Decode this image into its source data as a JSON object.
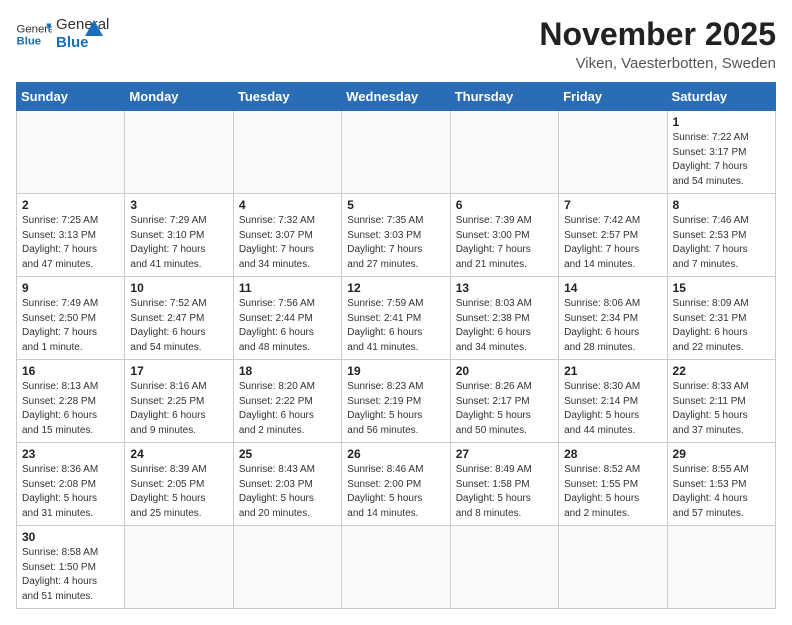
{
  "header": {
    "logo_general": "General",
    "logo_blue": "Blue",
    "title": "November 2025",
    "subtitle": "Viken, Vaesterbotten, Sweden"
  },
  "weekdays": [
    "Sunday",
    "Monday",
    "Tuesday",
    "Wednesday",
    "Thursday",
    "Friday",
    "Saturday"
  ],
  "weeks": [
    [
      {
        "day": "",
        "info": ""
      },
      {
        "day": "",
        "info": ""
      },
      {
        "day": "",
        "info": ""
      },
      {
        "day": "",
        "info": ""
      },
      {
        "day": "",
        "info": ""
      },
      {
        "day": "",
        "info": ""
      },
      {
        "day": "1",
        "info": "Sunrise: 7:22 AM\nSunset: 3:17 PM\nDaylight: 7 hours\nand 54 minutes."
      }
    ],
    [
      {
        "day": "2",
        "info": "Sunrise: 7:25 AM\nSunset: 3:13 PM\nDaylight: 7 hours\nand 47 minutes."
      },
      {
        "day": "3",
        "info": "Sunrise: 7:29 AM\nSunset: 3:10 PM\nDaylight: 7 hours\nand 41 minutes."
      },
      {
        "day": "4",
        "info": "Sunrise: 7:32 AM\nSunset: 3:07 PM\nDaylight: 7 hours\nand 34 minutes."
      },
      {
        "day": "5",
        "info": "Sunrise: 7:35 AM\nSunset: 3:03 PM\nDaylight: 7 hours\nand 27 minutes."
      },
      {
        "day": "6",
        "info": "Sunrise: 7:39 AM\nSunset: 3:00 PM\nDaylight: 7 hours\nand 21 minutes."
      },
      {
        "day": "7",
        "info": "Sunrise: 7:42 AM\nSunset: 2:57 PM\nDaylight: 7 hours\nand 14 minutes."
      },
      {
        "day": "8",
        "info": "Sunrise: 7:46 AM\nSunset: 2:53 PM\nDaylight: 7 hours\nand 7 minutes."
      }
    ],
    [
      {
        "day": "9",
        "info": "Sunrise: 7:49 AM\nSunset: 2:50 PM\nDaylight: 7 hours\nand 1 minute."
      },
      {
        "day": "10",
        "info": "Sunrise: 7:52 AM\nSunset: 2:47 PM\nDaylight: 6 hours\nand 54 minutes."
      },
      {
        "day": "11",
        "info": "Sunrise: 7:56 AM\nSunset: 2:44 PM\nDaylight: 6 hours\nand 48 minutes."
      },
      {
        "day": "12",
        "info": "Sunrise: 7:59 AM\nSunset: 2:41 PM\nDaylight: 6 hours\nand 41 minutes."
      },
      {
        "day": "13",
        "info": "Sunrise: 8:03 AM\nSunset: 2:38 PM\nDaylight: 6 hours\nand 34 minutes."
      },
      {
        "day": "14",
        "info": "Sunrise: 8:06 AM\nSunset: 2:34 PM\nDaylight: 6 hours\nand 28 minutes."
      },
      {
        "day": "15",
        "info": "Sunrise: 8:09 AM\nSunset: 2:31 PM\nDaylight: 6 hours\nand 22 minutes."
      }
    ],
    [
      {
        "day": "16",
        "info": "Sunrise: 8:13 AM\nSunset: 2:28 PM\nDaylight: 6 hours\nand 15 minutes."
      },
      {
        "day": "17",
        "info": "Sunrise: 8:16 AM\nSunset: 2:25 PM\nDaylight: 6 hours\nand 9 minutes."
      },
      {
        "day": "18",
        "info": "Sunrise: 8:20 AM\nSunset: 2:22 PM\nDaylight: 6 hours\nand 2 minutes."
      },
      {
        "day": "19",
        "info": "Sunrise: 8:23 AM\nSunset: 2:19 PM\nDaylight: 5 hours\nand 56 minutes."
      },
      {
        "day": "20",
        "info": "Sunrise: 8:26 AM\nSunset: 2:17 PM\nDaylight: 5 hours\nand 50 minutes."
      },
      {
        "day": "21",
        "info": "Sunrise: 8:30 AM\nSunset: 2:14 PM\nDaylight: 5 hours\nand 44 minutes."
      },
      {
        "day": "22",
        "info": "Sunrise: 8:33 AM\nSunset: 2:11 PM\nDaylight: 5 hours\nand 37 minutes."
      }
    ],
    [
      {
        "day": "23",
        "info": "Sunrise: 8:36 AM\nSunset: 2:08 PM\nDaylight: 5 hours\nand 31 minutes."
      },
      {
        "day": "24",
        "info": "Sunrise: 8:39 AM\nSunset: 2:05 PM\nDaylight: 5 hours\nand 25 minutes."
      },
      {
        "day": "25",
        "info": "Sunrise: 8:43 AM\nSunset: 2:03 PM\nDaylight: 5 hours\nand 20 minutes."
      },
      {
        "day": "26",
        "info": "Sunrise: 8:46 AM\nSunset: 2:00 PM\nDaylight: 5 hours\nand 14 minutes."
      },
      {
        "day": "27",
        "info": "Sunrise: 8:49 AM\nSunset: 1:58 PM\nDaylight: 5 hours\nand 8 minutes."
      },
      {
        "day": "28",
        "info": "Sunrise: 8:52 AM\nSunset: 1:55 PM\nDaylight: 5 hours\nand 2 minutes."
      },
      {
        "day": "29",
        "info": "Sunrise: 8:55 AM\nSunset: 1:53 PM\nDaylight: 4 hours\nand 57 minutes."
      }
    ],
    [
      {
        "day": "30",
        "info": "Sunrise: 8:58 AM\nSunset: 1:50 PM\nDaylight: 4 hours\nand 51 minutes."
      },
      {
        "day": "",
        "info": ""
      },
      {
        "day": "",
        "info": ""
      },
      {
        "day": "",
        "info": ""
      },
      {
        "day": "",
        "info": ""
      },
      {
        "day": "",
        "info": ""
      },
      {
        "day": "",
        "info": ""
      }
    ]
  ]
}
